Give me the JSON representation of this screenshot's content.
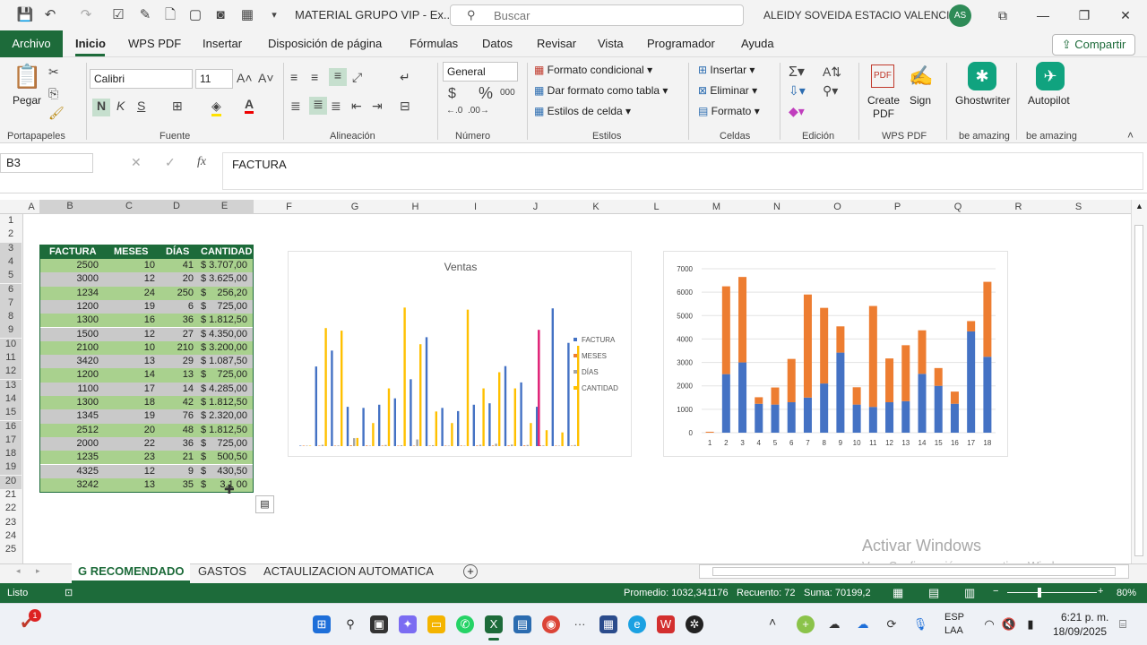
{
  "window": {
    "title": "MATERIAL GRUPO VIP  -  Ex...",
    "search_placeholder": "Buscar",
    "user_name": "ALEIDY SOVEIDA ESTACIO VALENCIA",
    "user_initials": "AS"
  },
  "menu": {
    "file": "Archivo",
    "tabs": [
      "Inicio",
      "WPS PDF",
      "Insertar",
      "Disposición de página",
      "Fórmulas",
      "Datos",
      "Revisar",
      "Vista",
      "Programador",
      "Ayuda"
    ],
    "share": "Compartir"
  },
  "ribbon": {
    "paste": "Pegar",
    "font_name": "Calibri",
    "font_size": "11",
    "number_format": "General",
    "cond_format": "Formato condicional",
    "table_format": "Dar formato como tabla",
    "cell_styles": "Estilos de celda",
    "insert": "Insertar",
    "delete": "Eliminar",
    "format": "Formato",
    "create_pdf": "Create PDF",
    "sign": "Sign",
    "ghostwriter": "Ghostwriter",
    "autopilot": "Autopilot",
    "bold": "N",
    "italic": "K",
    "underline": "S",
    "groups": {
      "clipboard": "Portapapeles",
      "font": "Fuente",
      "alignment": "Alineación",
      "number": "Número",
      "styles": "Estilos",
      "cells": "Celdas",
      "editing": "Edición",
      "wps_pdf": "WPS PDF",
      "amazing1": "be amazing",
      "amazing2": "be amazing"
    }
  },
  "formula_bar": {
    "name_box": "B3",
    "fx": "fx",
    "content": "FACTURA"
  },
  "grid": {
    "columns": [
      "A",
      "B",
      "C",
      "D",
      "E",
      "F",
      "G",
      "H",
      "I",
      "J",
      "K",
      "L",
      "M",
      "N",
      "O",
      "P",
      "Q",
      "R",
      "S"
    ],
    "rows": [
      "1",
      "2",
      "3",
      "4",
      "5",
      "6",
      "7",
      "8",
      "9",
      "10",
      "11",
      "12",
      "13",
      "14",
      "15",
      "16",
      "17",
      "18",
      "19",
      "20",
      "21",
      "22",
      "23",
      "24",
      "25"
    ]
  },
  "table": {
    "headers": [
      "FACTURA",
      "MESES",
      "DÍAS",
      "CANTIDAD"
    ],
    "currency": "$",
    "rows": [
      [
        "2500",
        "10",
        "41",
        "3.707,00"
      ],
      [
        "3000",
        "12",
        "20",
        "3.625,00"
      ],
      [
        "1234",
        "24",
        "250",
        "256,20"
      ],
      [
        "1200",
        "19",
        "6",
        "725,00"
      ],
      [
        "1300",
        "16",
        "36",
        "1.812,50"
      ],
      [
        "1500",
        "12",
        "27",
        "4.350,00"
      ],
      [
        "2100",
        "10",
        "210",
        "3.200,00"
      ],
      [
        "3420",
        "13",
        "29",
        "1.087,50"
      ],
      [
        "1200",
        "14",
        "13",
        "725,00"
      ],
      [
        "1100",
        "17",
        "14",
        "4.285,00"
      ],
      [
        "1300",
        "18",
        "42",
        "1.812,50"
      ],
      [
        "1345",
        "19",
        "76",
        "2.320,00"
      ],
      [
        "2512",
        "20",
        "48",
        "1.812,50"
      ],
      [
        "2000",
        "22",
        "36",
        "725,00"
      ],
      [
        "1235",
        "23",
        "21",
        "500,50"
      ],
      [
        "4325",
        "12",
        "9",
        "430,50"
      ],
      [
        "3242",
        "13",
        "35",
        "3.1__,00"
      ]
    ],
    "last_amount_visible": "3.1   00"
  },
  "chart_data": [
    {
      "type": "bar",
      "title": "Ventas",
      "series": [
        {
          "name": "FACTURA",
          "color": "#4472c4",
          "values": [
            0,
            2500,
            3000,
            1234,
            1200,
            1300,
            1500,
            2100,
            3420,
            1200,
            1100,
            1300,
            1345,
            2512,
            2000,
            1235,
            4325,
            3242
          ]
        },
        {
          "name": "MESES",
          "color": "#ed7d31",
          "values": [
            0,
            10,
            12,
            24,
            19,
            16,
            12,
            10,
            13,
            14,
            17,
            18,
            19,
            20,
            22,
            23,
            12,
            13
          ]
        },
        {
          "name": "DÍAS",
          "color": "#a5a5a5",
          "values": [
            0,
            41,
            20,
            250,
            6,
            36,
            27,
            210,
            29,
            13,
            14,
            42,
            76,
            48,
            36,
            21,
            9,
            35
          ]
        },
        {
          "name": "CANTIDAD",
          "color": "#ffc000",
          "values": [
            0,
            3707,
            3625,
            256.2,
            725,
            1812.5,
            4350,
            3200,
            1087.5,
            725,
            4285,
            1812.5,
            2320,
            1812.5,
            725,
            500.5,
            430.5,
            3150
          ]
        }
      ],
      "highlight_bar": {
        "color": "#e0287a",
        "value": 3650
      },
      "legend": "right"
    },
    {
      "type": "bar",
      "stacked": true,
      "categories": [
        "1",
        "2",
        "3",
        "4",
        "5",
        "6",
        "7",
        "8",
        "9",
        "10",
        "11",
        "12",
        "13",
        "14",
        "15",
        "16",
        "17",
        "18"
      ],
      "y_ticks": [
        0,
        1000,
        2000,
        3000,
        4000,
        5000,
        6000,
        7000
      ],
      "ylim": [
        0,
        7000
      ],
      "series": [
        {
          "name": "blue",
          "color": "#4472c4",
          "values": [
            0,
            2500,
            3000,
            1234,
            1200,
            1300,
            1500,
            2100,
            3420,
            1200,
            1100,
            1300,
            1345,
            2512,
            2000,
            1235,
            4325,
            3242
          ]
        },
        {
          "name": "orange",
          "color": "#ed7d31",
          "values": [
            40,
            3750,
            3650,
            280,
            730,
            1850,
            4400,
            3230,
            1120,
            740,
            4310,
            1870,
            2390,
            1860,
            760,
            520,
            440,
            3200
          ]
        }
      ]
    }
  ],
  "sheets": {
    "tabs": [
      "G RECOMENDADO",
      "GASTOS",
      "ACTAULIZACION AUTOMATICA"
    ],
    "active": "G RECOMENDADO"
  },
  "status": {
    "ready": "Listo",
    "average": "Promedio: 1032,341176",
    "count": "Recuento: 72",
    "sum": "Suma: 70199,2",
    "zoom": "80%"
  },
  "watermark": {
    "line1": "Activar Windows",
    "line2": "Ve a Configuración para activar Windows."
  },
  "taskbar": {
    "lang1": "ESP",
    "lang2": "LAA",
    "time": "6:21 p. m.",
    "date": "18/09/2025",
    "badge": "1"
  }
}
